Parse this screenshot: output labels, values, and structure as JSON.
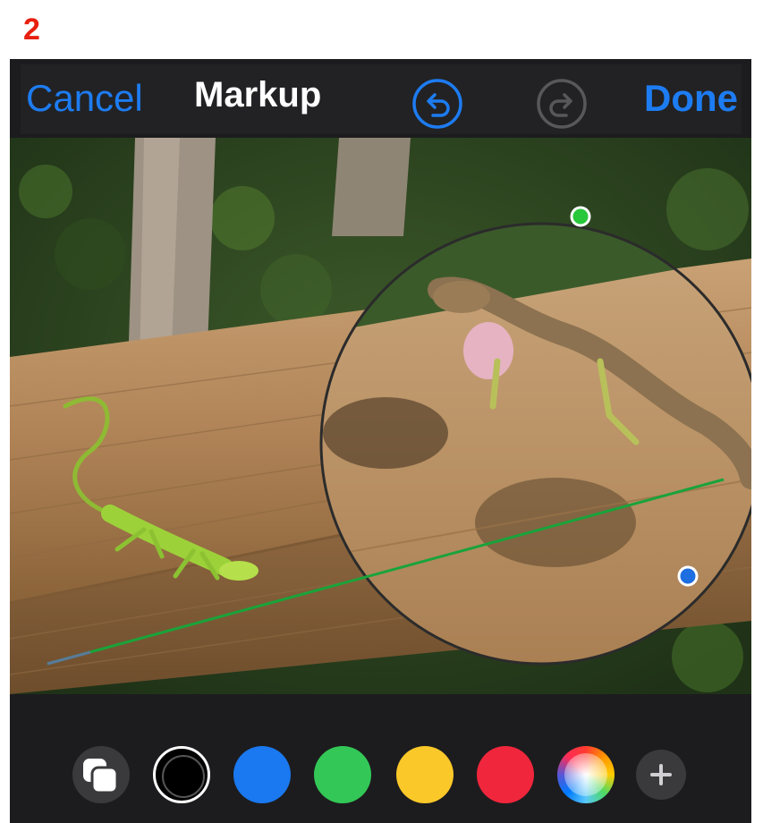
{
  "step_label": "2",
  "header": {
    "cancel_label": "Cancel",
    "title": "Markup",
    "done_label": "Done"
  },
  "colors": {
    "accent": "#1d7cf2",
    "step_red": "#e8200f",
    "line_green": "#1aa33a",
    "handle_green": "#29c73c",
    "handle_blue": "#1d6ee0"
  },
  "image": {
    "subject": "two anole lizards on a wooden railing with a magnifier loupe"
  },
  "palette": [
    {
      "name": "black",
      "color": "#000000"
    },
    {
      "name": "blue",
      "color": "#1a78f0"
    },
    {
      "name": "green",
      "color": "#33c757"
    },
    {
      "name": "yellow",
      "color": "#fbc82a"
    },
    {
      "name": "red",
      "color": "#f0263c"
    }
  ],
  "icons": [
    "layers-icon",
    "undo-icon",
    "redo-icon",
    "color-wheel-icon",
    "plus-icon"
  ]
}
